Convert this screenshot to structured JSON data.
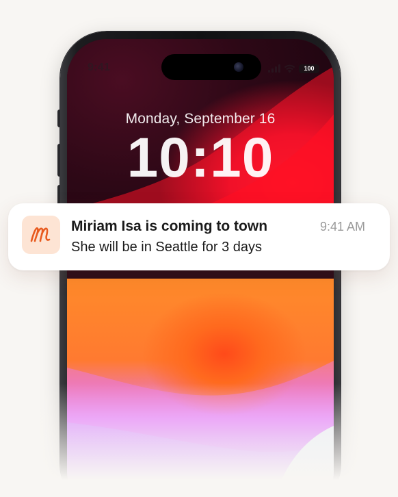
{
  "status_bar": {
    "time": "9:41",
    "battery": "100",
    "icons": [
      "cellular-signal-icon",
      "wifi-icon",
      "battery-icon"
    ]
  },
  "lock_screen": {
    "date": "Monday, September 16",
    "time": "10:10"
  },
  "notification": {
    "app_icon": "cursive-m-app-icon",
    "title": "Miriam Isa is coming to town",
    "body": "She will be in Seattle for 3 days",
    "timestamp": "9:41 AM"
  },
  "colors": {
    "page_background": "#f8f6f3",
    "app_icon_background": "#fde4d4",
    "app_icon_glyph": "#e85a1e",
    "notification_background": "#ffffff",
    "timestamp_gray": "#9a9a9a"
  }
}
